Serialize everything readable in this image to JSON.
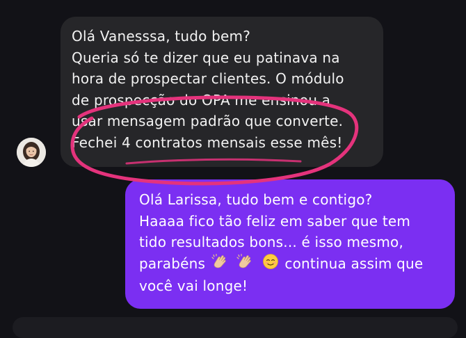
{
  "incoming_message": {
    "sender_avatar": "avatar-photo",
    "lines": [
      "Olá Vanesssa, tudo bem?",
      "Queria só te dizer que eu patinava na",
      "hora de prospectar clientes. O módulo",
      "de prospecção do OPA me ensinou a",
      "usar mensagem padrão que converte.",
      "Fechei 4 contratos mensais esse mês!"
    ]
  },
  "outgoing_message": {
    "lines": [
      "Olá Larissa, tudo bem e contigo?",
      "Haaaa fico tão feliz em saber que tem",
      "tido resultados bons... é isso mesmo,"
    ],
    "line4_before": "parabéns",
    "line4_emojis": [
      "clapping-hands-emoji",
      "clapping-hands-emoji",
      "smiling-face-emoji"
    ],
    "line4_after": "continua assim que",
    "line5": "você vai longe!"
  },
  "colors": {
    "background": "#121217",
    "incoming_bubble": "#262629",
    "outgoing_bubble": "#7b2ff2",
    "annotation_ring": "#e4337c"
  }
}
